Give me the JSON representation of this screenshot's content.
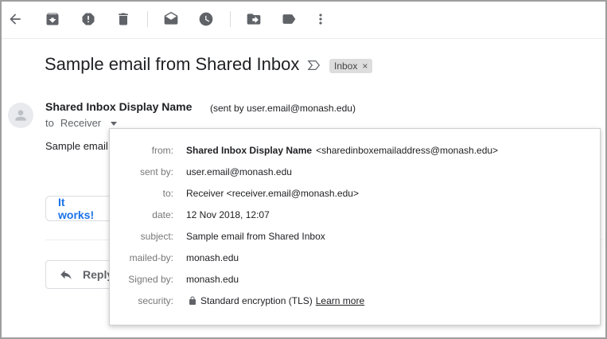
{
  "toolbar": {
    "icons": [
      "back-arrow-icon",
      "archive-icon",
      "report-spam-icon",
      "delete-icon",
      "mark-unread-icon",
      "snooze-icon",
      "move-to-icon",
      "label-icon",
      "more-options-icon"
    ]
  },
  "email": {
    "subject": "Sample email from Shared Inbox",
    "label": "Inbox",
    "label_remove": "×",
    "sender_name": "Shared Inbox Display Name",
    "sent_by_note": "(sent by user.email@monash.edu)",
    "to_prefix": "to",
    "recipient": "Receiver",
    "body_preview": "Sample email",
    "smart_reply": "It works!",
    "reply_label": "Reply"
  },
  "details": {
    "rows": [
      {
        "key": "from:",
        "name": "Shared Inbox Display Name",
        "value": "<sharedinboxemailaddress@monash.edu>"
      },
      {
        "key": "sent by:",
        "value": "user.email@monash.edu"
      },
      {
        "key": "to:",
        "value": "Receiver <receiver.email@monash.edu>"
      },
      {
        "key": "date:",
        "value": "12 Nov 2018, 12:07"
      },
      {
        "key": "subject:",
        "value": "Sample email from Shared Inbox"
      },
      {
        "key": "mailed-by:",
        "value": "monash.edu"
      },
      {
        "key": "Signed by:",
        "value": "monash.edu"
      },
      {
        "key": "security:",
        "value": "Standard encryption (TLS)",
        "link": "Learn more"
      }
    ]
  },
  "colors": {
    "accent_blue": "#1a73e8",
    "icon_grey": "#5f6368",
    "label_chip_bg": "#dddddd"
  }
}
